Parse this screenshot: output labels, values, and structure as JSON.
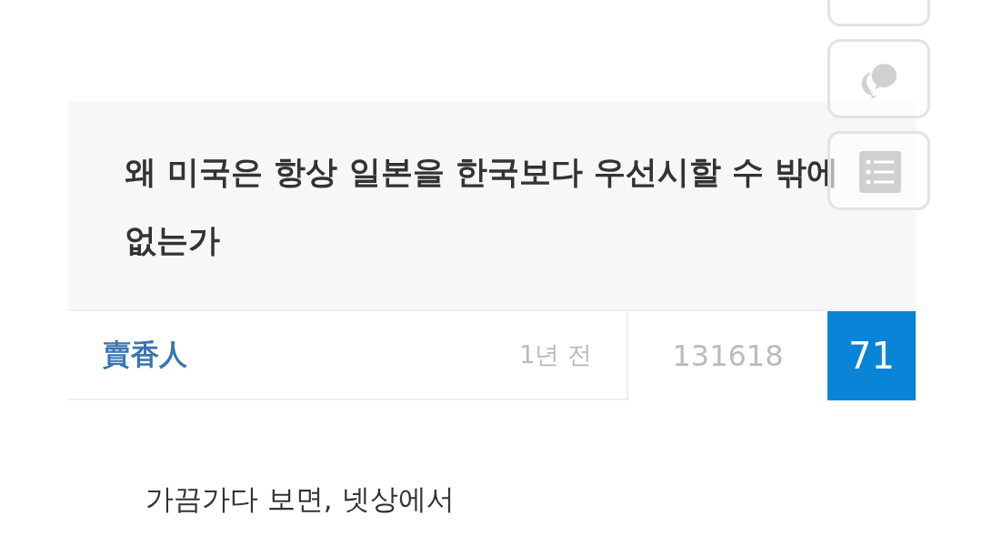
{
  "post": {
    "title": "왜 미국은 항상 일본을 한국보다 우선시할 수 밖에 없는가",
    "author": "賣香人",
    "time": "1년 전",
    "views": "131618",
    "comments": "71",
    "body": [
      "가끔가다 보면, 넷상에서"
    ]
  },
  "floating_buttons": [
    {
      "kind": "blank"
    },
    {
      "kind": "chat"
    },
    {
      "kind": "list"
    }
  ]
}
